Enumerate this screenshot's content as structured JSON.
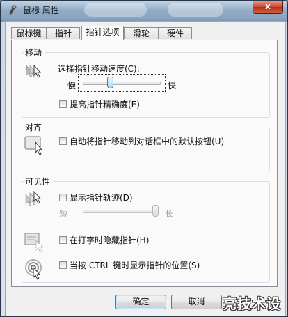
{
  "window": {
    "title": "鼠标 属性",
    "close_label": "x"
  },
  "tabs": [
    {
      "label": "鼠标键",
      "active": false
    },
    {
      "label": "指针",
      "active": false
    },
    {
      "label": "指针选项",
      "active": true
    },
    {
      "label": "滑轮",
      "active": false
    },
    {
      "label": "硬件",
      "active": false
    }
  ],
  "motion": {
    "group_label": "移动",
    "speed_label": "选择指针移动速度(C):",
    "slow_label": "慢",
    "fast_label": "快",
    "speed_level": 0.35,
    "precision_label": "提高指针精确度(E)",
    "precision_checked": false
  },
  "snap": {
    "group_label": "对齐",
    "snap_label": "自动将指针移动到对话框中的默认按钮(U)",
    "snap_checked": false
  },
  "visibility": {
    "group_label": "可见性",
    "trails_label": "显示指针轨迹(D)",
    "trails_checked": false,
    "short_label": "短",
    "long_label": "长",
    "trail_level": 1.0,
    "hide_label": "在打字时隐藏指针(H)",
    "hide_checked": false,
    "ctrl_label": "当按 CTRL 键时显示指针的位置(S)",
    "ctrl_checked": false
  },
  "buttons": {
    "ok": "确定",
    "cancel": "取消"
  },
  "watermark": "亮技术设"
}
